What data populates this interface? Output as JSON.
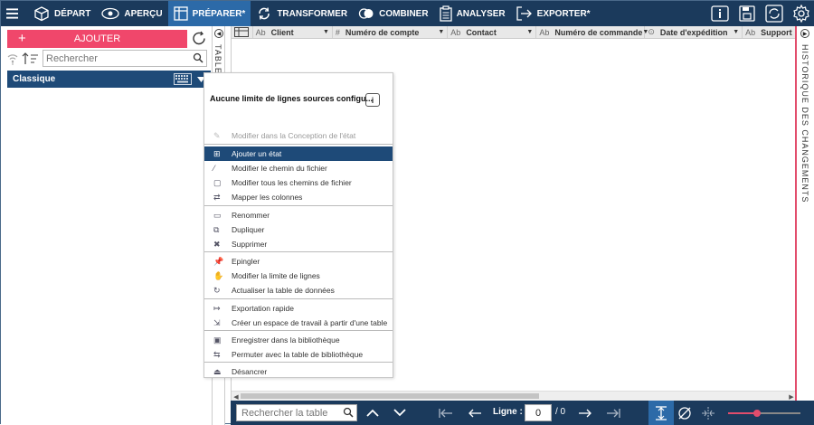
{
  "nav": {
    "items": [
      {
        "label": "DÉPART",
        "icon": "cube-icon"
      },
      {
        "label": "APERÇU",
        "icon": "eye-icon"
      },
      {
        "label": "PRÉPARER*",
        "icon": "table-icon",
        "active": true
      },
      {
        "label": "TRANSFORMER",
        "icon": "cycle-icon"
      },
      {
        "label": "COMBINER",
        "icon": "combine-icon"
      },
      {
        "label": "ANALYSER",
        "icon": "clipboard-icon"
      },
      {
        "label": "EXPORTER*",
        "icon": "export-icon"
      }
    ]
  },
  "left": {
    "add_label": "AJOUTER",
    "search_placeholder": "Rechercher",
    "group_label": "Classique"
  },
  "vtab_label": "TABLES",
  "history_label": "HISTORIQUE DES CHANGEMENTS",
  "grid": {
    "columns": [
      {
        "type": "Ab",
        "name": "Client"
      },
      {
        "type": "#",
        "name": "Numéro de compte"
      },
      {
        "type": "Ab",
        "name": "Contact"
      },
      {
        "type": "Ab",
        "name": "Numéro de commande"
      },
      {
        "type": "⊙",
        "name": "Date d'expédition"
      },
      {
        "type": "Ab",
        "name": "Support"
      }
    ]
  },
  "bottom": {
    "search_placeholder": "Rechercher la table",
    "ligne_label": "Ligne :",
    "ligne_value": "0",
    "ligne_total": "/ 0",
    "zoom_fraction": 0.4
  },
  "menu": {
    "title": "Aucune limite de lignes sources configu...",
    "info": "i",
    "items": [
      {
        "label": "Modifier dans la Conception de l'état",
        "disabled": true
      },
      {
        "label": "Ajouter un état",
        "selected": true
      },
      {
        "label": "Modifier le chemin du fichier"
      },
      {
        "label": "Modifier tous les chemins de fichier"
      },
      {
        "label": "Mapper les colonnes"
      },
      {
        "label": "Renommer"
      },
      {
        "label": "Dupliquer"
      },
      {
        "label": "Supprimer"
      },
      {
        "label": "Epingler"
      },
      {
        "label": "Modifier la limite de lignes"
      },
      {
        "label": "Actualiser la table de données"
      },
      {
        "label": "Exportation rapide"
      },
      {
        "label": "Créer un espace de travail à partir d'une table"
      },
      {
        "label": "Enregistrer dans la bibliothèque"
      },
      {
        "label": "Permuter avec la table de bibliothèque"
      },
      {
        "label": "Désancrer"
      }
    ]
  }
}
